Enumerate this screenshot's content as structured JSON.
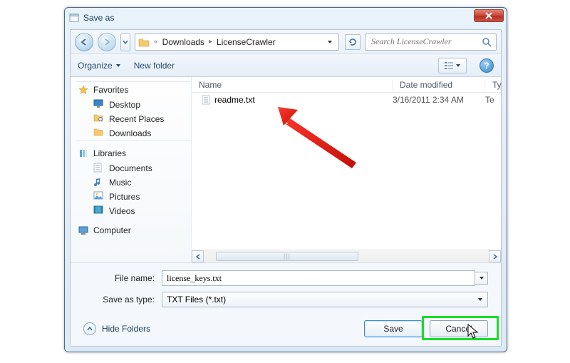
{
  "window": {
    "title": "Save as"
  },
  "breadcrumb": {
    "level1": "Downloads",
    "level2": "LicenseCrawler"
  },
  "search": {
    "placeholder": "Search LicenseCrawler"
  },
  "toolbar": {
    "organize": "Organize",
    "newfolder": "New folder"
  },
  "navpane": {
    "favorites": {
      "label": "Favorites"
    },
    "desktop": {
      "label": "Desktop"
    },
    "recent": {
      "label": "Recent Places"
    },
    "downloads": {
      "label": "Downloads"
    },
    "libraries": {
      "label": "Libraries"
    },
    "documents": {
      "label": "Documents"
    },
    "music": {
      "label": "Music"
    },
    "pictures": {
      "label": "Pictures"
    },
    "videos": {
      "label": "Videos"
    },
    "computer": {
      "label": "Computer"
    }
  },
  "listhead": {
    "name": "Name",
    "date": "Date modified",
    "type": "Ty"
  },
  "files": [
    {
      "name": "readme.txt",
      "date": "3/16/2011 2:34 AM",
      "type": "Te"
    }
  ],
  "fields": {
    "filename_label": "File name:",
    "filename_value": "license_keys.txt",
    "saveastype_label": "Save as type:",
    "saveastype_value": "TXT Files (*.txt)"
  },
  "footer": {
    "hide_folders": "Hide Folders",
    "save": "Save",
    "cancel": "Cancel"
  }
}
